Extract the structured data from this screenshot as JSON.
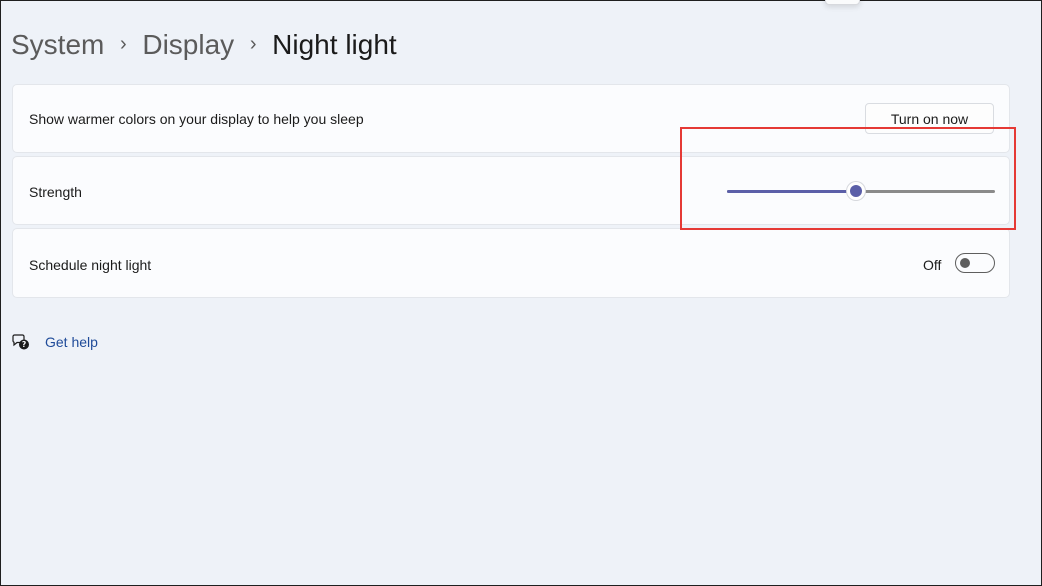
{
  "breadcrumb": {
    "items": [
      "System",
      "Display",
      "Night light"
    ],
    "separator": "›"
  },
  "settings": {
    "warmer_colors": {
      "label": "Show warmer colors on your display to help you sleep",
      "button_label": "Turn on now"
    },
    "strength": {
      "label": "Strength",
      "value": 48,
      "value_text": "48",
      "min": 0,
      "max": 100
    },
    "schedule": {
      "label": "Schedule night light",
      "state_text": "Off",
      "enabled": false
    }
  },
  "help": {
    "label": "Get help",
    "icon": "help-chat-icon"
  },
  "colors": {
    "accent": "#5b5fa8",
    "highlight": "#e53935",
    "link": "#1f4b99"
  }
}
